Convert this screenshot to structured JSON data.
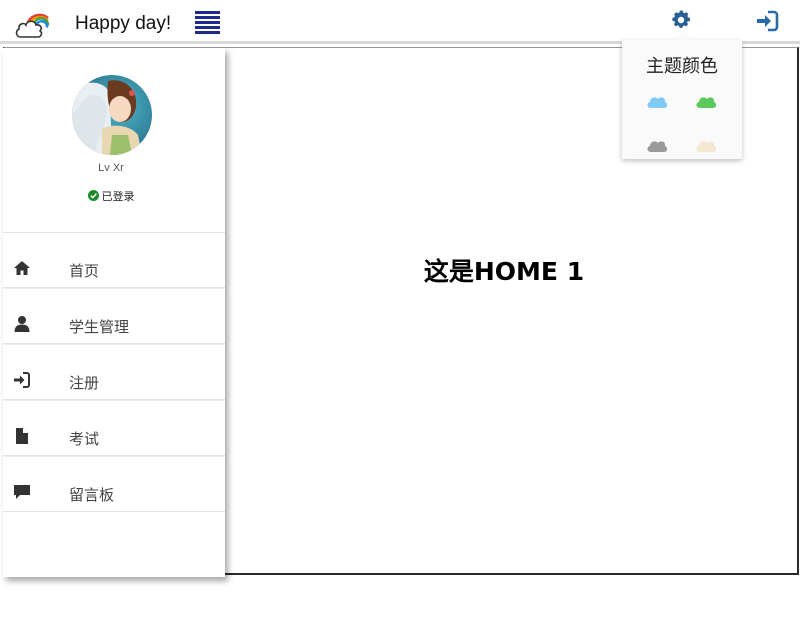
{
  "header": {
    "title": "Happy day!",
    "logo_icon": "cloud-rainbow-icon",
    "menu_icon": "hamburger-icon",
    "menu_color": "#1f2a8f",
    "settings_icon": "gear-icon",
    "login_icon": "sign-in-icon",
    "icon_color": "#2a6aa8"
  },
  "profile": {
    "name": "Lv Xr",
    "status": "已登录",
    "status_color": "#1a8a2a"
  },
  "sidebar": {
    "items": [
      {
        "label": "首页",
        "icon": "home-icon"
      },
      {
        "label": "学生管理",
        "icon": "user-icon"
      },
      {
        "label": "注册",
        "icon": "sign-in-icon"
      },
      {
        "label": "考试",
        "icon": "file-icon"
      },
      {
        "label": "留言板",
        "icon": "comment-icon"
      }
    ]
  },
  "main": {
    "heading": "这是HOME 1"
  },
  "theme_panel": {
    "title": "主题颜色",
    "colors": [
      {
        "name": "blue",
        "hex": "#7ecbf5"
      },
      {
        "name": "green",
        "hex": "#5cc95c"
      },
      {
        "name": "gray",
        "hex": "#9a9a9a"
      },
      {
        "name": "cream",
        "hex": "#f3e7cf"
      }
    ]
  }
}
